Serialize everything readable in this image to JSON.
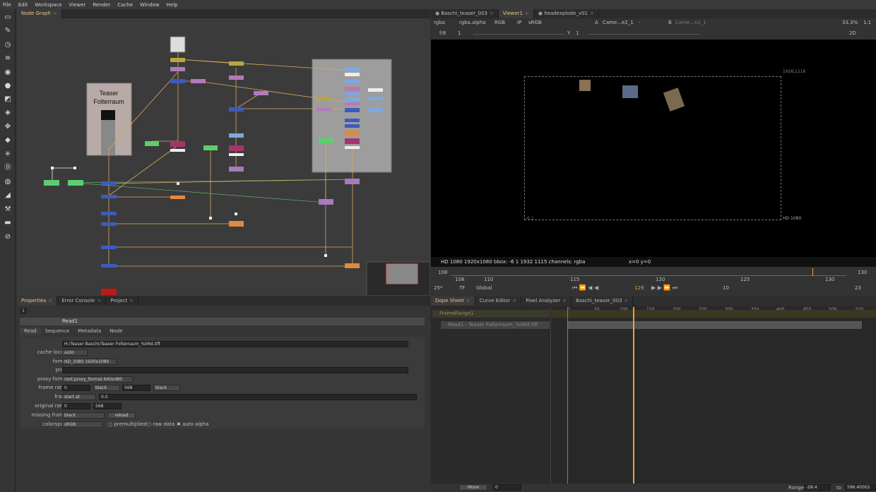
{
  "menu": [
    "File",
    "Edit",
    "Workspace",
    "Viewer",
    "Render",
    "Cache",
    "Window",
    "Help"
  ],
  "node_graph": {
    "tab": "Node Graph",
    "backdrop_title": "Teaser\nFolterraum"
  },
  "viewer": {
    "tabs": [
      "Baschi_teaser_003",
      "Viewer1",
      "headexplode_v01"
    ],
    "channels": "rgba",
    "alpha": "rgba.alpha",
    "colorspace_mode": "RGB",
    "ip": "IP",
    "lut": "sRGB",
    "input_a": "Came...e2_1",
    "input_a_op": "-",
    "input_b": "Came...e2_1",
    "zoom": "33.3%",
    "ratio": "1:1",
    "view_mode": "2D",
    "fstop": "f/8",
    "gain": "1",
    "gamma_label": "Y",
    "gamma": "1",
    "format_tr": "1926,1116",
    "format_br": "HD 1080",
    "format_bl": "-6,1",
    "status": "HD 1080 1920x1080  bbox: -6 1 1932 1115 channels: rgba",
    "coords": "x=0 y=0",
    "timeline": {
      "start": "108",
      "end": "130",
      "ticks": [
        "108",
        "110",
        "115",
        "120",
        "125",
        "130"
      ],
      "current": "129",
      "fps": "25*",
      "tf": "TF",
      "global": "Global",
      "frame_box": "129",
      "step": "10",
      "end_frame": "23"
    }
  },
  "properties": {
    "tabs": [
      "Properties",
      "Error Console",
      "Project"
    ],
    "node_name": "Read1",
    "count": "1",
    "subtabs": [
      "Read",
      "Sequence",
      "Metadata",
      "Node"
    ],
    "rows": [
      {
        "label": "file",
        "value": "H:/Teaser Baschi/Teaser Folterraum_%06d.tiff"
      },
      {
        "label": "cache locally",
        "value": "auto"
      },
      {
        "label": "format",
        "value": "HD_1080 1920x1080"
      },
      {
        "label": "proxy",
        "value": ""
      },
      {
        "label": "proxy format",
        "value": "root.proxy_format 640x480"
      },
      {
        "label": "frame range",
        "v1": "0",
        "v2": "black",
        "v3": "568",
        "v4": "black"
      },
      {
        "label": "frame",
        "v1": "start at",
        "v2": "0.0"
      },
      {
        "label": "original range",
        "v1": "0",
        "v2": "568"
      },
      {
        "label": "missing frames",
        "v1": "black",
        "v2": "reload"
      },
      {
        "label": "colorspace",
        "value": "sRGB",
        "premult": "premultiplied",
        "raw": "raw data",
        "auto": "auto alpha"
      }
    ]
  },
  "dopesheet": {
    "tabs": [
      "Dope Sheet",
      "Curve Editor",
      "Pixel Analyzer",
      "Baschi_teaser_003"
    ],
    "items": [
      "FrameRange1",
      "Read1 - Teaser Folterraum_%06d.tiff"
    ],
    "ticks": [
      "0",
      "50",
      "100",
      "150",
      "200",
      "250",
      "300",
      "350",
      "400",
      "450",
      "500",
      "550"
    ],
    "move_label": "Move",
    "move_value": "0",
    "range_label": "Range",
    "range_start": "-28.4",
    "range_to": "to",
    "range_end": "596.40002"
  },
  "colors": {
    "accent": "#e6c48a",
    "playhead": "#f0a040"
  }
}
